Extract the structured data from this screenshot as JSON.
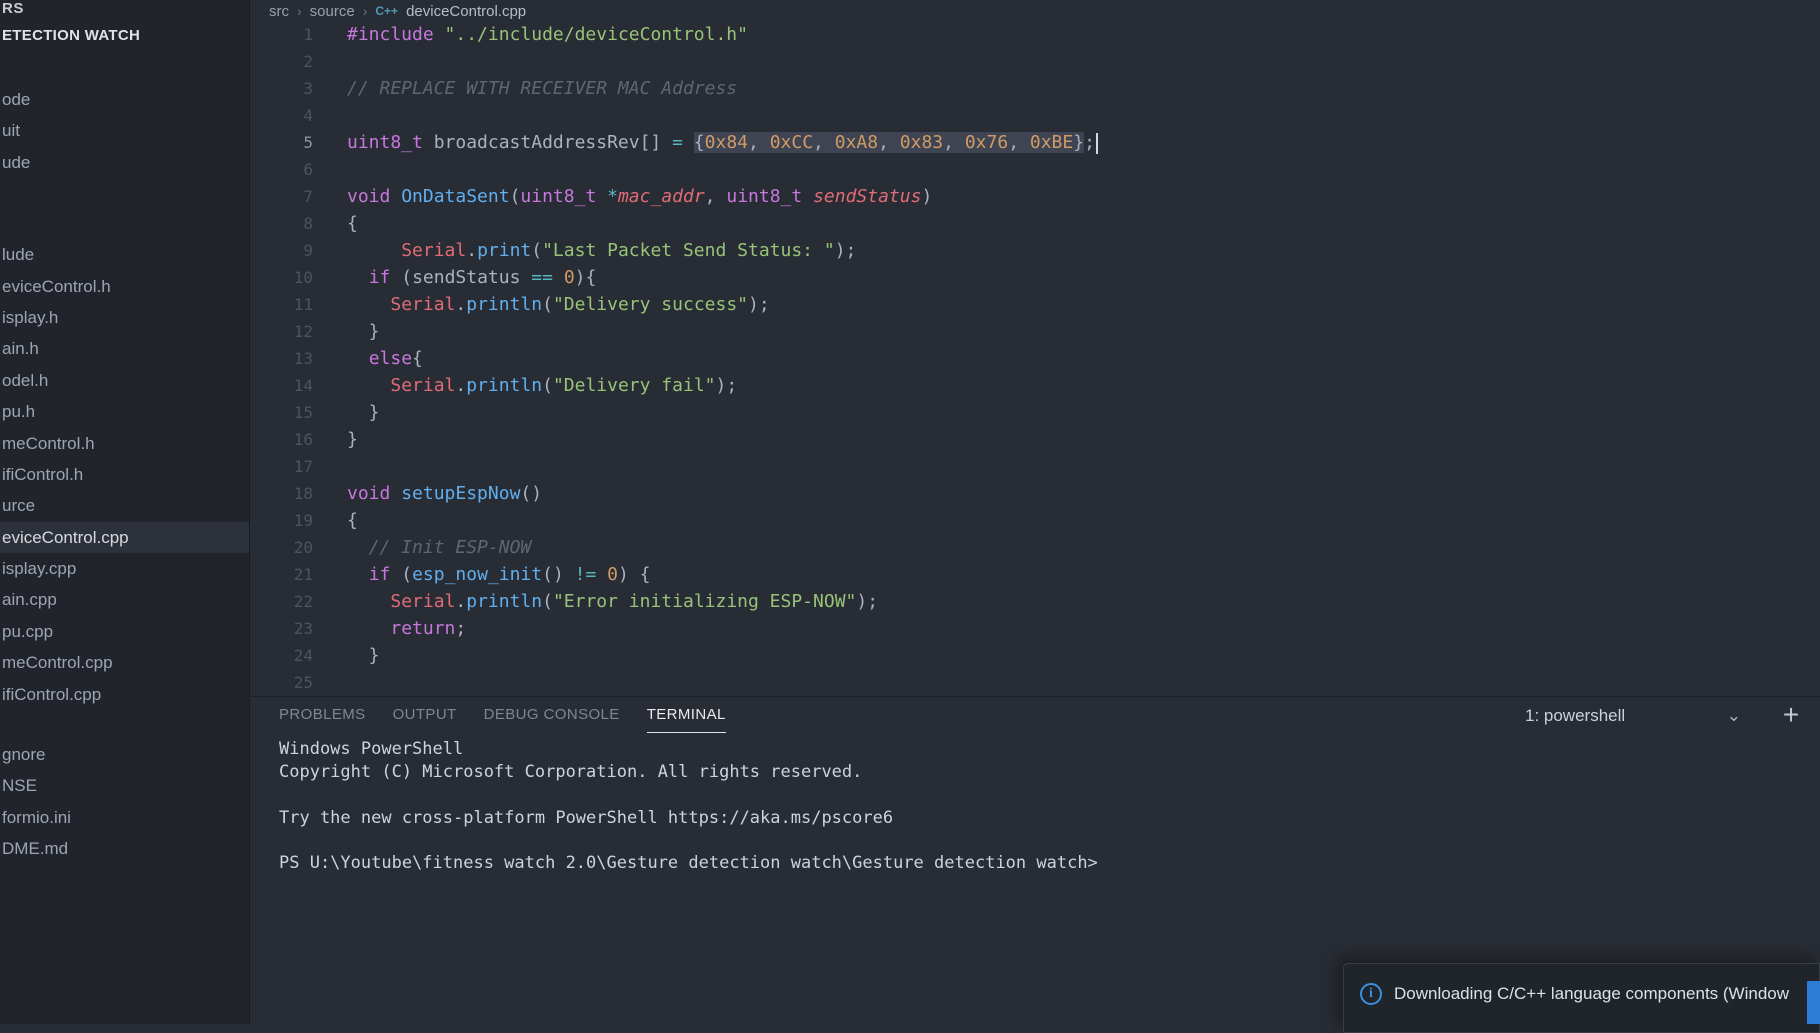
{
  "colors": {
    "editor_bg": "#282c34",
    "sidebar_bg": "#21252b",
    "keyword": "#c678dd",
    "function": "#61afef",
    "string": "#98c379",
    "number": "#d19a66",
    "comment": "#5c6370",
    "variable": "#e06c75",
    "operator": "#56b6c2",
    "selection": "#3e4451",
    "info_blue": "#3d8fd9",
    "file_icon_blue": "#519aba"
  },
  "sidebar": {
    "top_label": "RS",
    "section_header": "ETECTION WATCH",
    "groups": [
      {
        "items": [
          {
            "label": "ode"
          },
          {
            "label": "uit"
          },
          {
            "label": "ude"
          }
        ]
      },
      {
        "items": [
          {
            "label": "lude"
          },
          {
            "label": "eviceControl.h"
          },
          {
            "label": "isplay.h"
          },
          {
            "label": "ain.h"
          },
          {
            "label": "odel.h"
          },
          {
            "label": "pu.h"
          },
          {
            "label": "meControl.h"
          },
          {
            "label": "ifiControl.h"
          },
          {
            "label": "urce"
          },
          {
            "label": "eviceControl.cpp",
            "selected": true
          },
          {
            "label": "isplay.cpp"
          },
          {
            "label": "ain.cpp"
          },
          {
            "label": "pu.cpp"
          },
          {
            "label": "meControl.cpp"
          },
          {
            "label": "ifiControl.cpp"
          }
        ]
      },
      {
        "items": [
          {
            "label": "gnore"
          },
          {
            "label": "NSE"
          },
          {
            "label": "formio.ini"
          },
          {
            "label": "DME.md"
          }
        ]
      }
    ]
  },
  "editor": {
    "breadcrumb": {
      "parts": [
        "src",
        "source",
        "deviceControl.cpp"
      ],
      "separator": "›",
      "file_icon": "C++"
    },
    "lines": [
      {
        "num": 1,
        "tokens": [
          [
            "kw",
            "#include"
          ],
          [
            "p",
            " "
          ],
          [
            "str",
            "\"../include/deviceControl.h\""
          ]
        ]
      },
      {
        "num": 2,
        "tokens": []
      },
      {
        "num": 3,
        "tokens": [
          [
            "cmt",
            "// REPLACE WITH RECEIVER MAC Address"
          ]
        ]
      },
      {
        "num": 4,
        "tokens": []
      },
      {
        "num": 5,
        "active": true,
        "cursor": true,
        "tokens": [
          [
            "kw",
            "uint8_t"
          ],
          [
            "p",
            " broadcastAddressRev[] "
          ],
          [
            "op",
            "="
          ],
          [
            "p",
            " "
          ],
          [
            "p",
            "{",
            1
          ],
          [
            "num",
            "0x84",
            1
          ],
          [
            "p",
            ", ",
            1
          ],
          [
            "num",
            "0xCC",
            1
          ],
          [
            "p",
            ", ",
            1
          ],
          [
            "num",
            "0xA8",
            1
          ],
          [
            "p",
            ", ",
            1
          ],
          [
            "num",
            "0x83",
            1
          ],
          [
            "p",
            ", ",
            1
          ],
          [
            "num",
            "0x76",
            1
          ],
          [
            "p",
            ", ",
            1
          ],
          [
            "num",
            "0xBE",
            1
          ],
          [
            "p",
            "}",
            1
          ],
          [
            "p",
            ";"
          ]
        ]
      },
      {
        "num": 6,
        "tokens": []
      },
      {
        "num": 7,
        "tokens": [
          [
            "kw",
            "void"
          ],
          [
            "p",
            " "
          ],
          [
            "fn",
            "OnDataSent"
          ],
          [
            "p",
            "("
          ],
          [
            "kw",
            "uint8_t"
          ],
          [
            "p",
            " "
          ],
          [
            "op",
            "*"
          ],
          [
            "vi",
            "mac_addr"
          ],
          [
            "p",
            ", "
          ],
          [
            "kw",
            "uint8_t"
          ],
          [
            "p",
            " "
          ],
          [
            "vi",
            "sendStatus"
          ],
          [
            "p",
            ")"
          ]
        ]
      },
      {
        "num": 8,
        "tokens": [
          [
            "p",
            "{"
          ]
        ]
      },
      {
        "num": 9,
        "tokens": [
          [
            "p",
            "     "
          ],
          [
            "obj",
            "Serial"
          ],
          [
            "p",
            "."
          ],
          [
            "fn",
            "print"
          ],
          [
            "p",
            "("
          ],
          [
            "str",
            "\"Last Packet Send Status: \""
          ],
          [
            "p",
            ");"
          ]
        ]
      },
      {
        "num": 10,
        "tokens": [
          [
            "p",
            "  "
          ],
          [
            "kw",
            "if"
          ],
          [
            "p",
            " ("
          ],
          [
            "p",
            "sendStatus"
          ],
          [
            "p",
            " "
          ],
          [
            "op",
            "=="
          ],
          [
            "p",
            " "
          ],
          [
            "num",
            "0"
          ],
          [
            "p",
            "){"
          ]
        ]
      },
      {
        "num": 11,
        "tokens": [
          [
            "p",
            "    "
          ],
          [
            "obj",
            "Serial"
          ],
          [
            "p",
            "."
          ],
          [
            "fn",
            "println"
          ],
          [
            "p",
            "("
          ],
          [
            "str",
            "\"Delivery success\""
          ],
          [
            "p",
            ");"
          ]
        ]
      },
      {
        "num": 12,
        "tokens": [
          [
            "p",
            "  }"
          ]
        ]
      },
      {
        "num": 13,
        "tokens": [
          [
            "p",
            "  "
          ],
          [
            "kw",
            "else"
          ],
          [
            "p",
            "{"
          ]
        ]
      },
      {
        "num": 14,
        "tokens": [
          [
            "p",
            "    "
          ],
          [
            "obj",
            "Serial"
          ],
          [
            "p",
            "."
          ],
          [
            "fn",
            "println"
          ],
          [
            "p",
            "("
          ],
          [
            "str",
            "\"Delivery fail\""
          ],
          [
            "p",
            ");"
          ]
        ]
      },
      {
        "num": 15,
        "tokens": [
          [
            "p",
            "  }"
          ]
        ]
      },
      {
        "num": 16,
        "tokens": [
          [
            "p",
            "}"
          ]
        ]
      },
      {
        "num": 17,
        "tokens": []
      },
      {
        "num": 18,
        "tokens": [
          [
            "kw",
            "void"
          ],
          [
            "p",
            " "
          ],
          [
            "fn",
            "setupEspNow"
          ],
          [
            "p",
            "()"
          ]
        ]
      },
      {
        "num": 19,
        "tokens": [
          [
            "p",
            "{"
          ]
        ]
      },
      {
        "num": 20,
        "tokens": [
          [
            "p",
            "  "
          ],
          [
            "cmt",
            "// Init ESP-NOW"
          ]
        ]
      },
      {
        "num": 21,
        "tokens": [
          [
            "p",
            "  "
          ],
          [
            "kw",
            "if"
          ],
          [
            "p",
            " ("
          ],
          [
            "fn",
            "esp_now_init"
          ],
          [
            "p",
            "() "
          ],
          [
            "op",
            "!="
          ],
          [
            "p",
            " "
          ],
          [
            "num",
            "0"
          ],
          [
            "p",
            ") {"
          ]
        ]
      },
      {
        "num": 22,
        "tokens": [
          [
            "p",
            "    "
          ],
          [
            "obj",
            "Serial"
          ],
          [
            "p",
            "."
          ],
          [
            "fn",
            "println"
          ],
          [
            "p",
            "("
          ],
          [
            "str",
            "\"Error initializing ESP-NOW\""
          ],
          [
            "p",
            ");"
          ]
        ]
      },
      {
        "num": 23,
        "tokens": [
          [
            "p",
            "    "
          ],
          [
            "kw",
            "return"
          ],
          [
            "p",
            ";"
          ]
        ]
      },
      {
        "num": 24,
        "tokens": [
          [
            "p",
            "  }"
          ]
        ]
      },
      {
        "num": 25,
        "tokens": []
      }
    ]
  },
  "panel": {
    "tabs": [
      {
        "label": "PROBLEMS"
      },
      {
        "label": "OUTPUT"
      },
      {
        "label": "DEBUG CONSOLE"
      },
      {
        "label": "TERMINAL",
        "active": true
      }
    ],
    "terminal_selector": {
      "value": "1: powershell",
      "chevron": "⌄"
    },
    "add_terminal_label": "+",
    "terminal": {
      "lines": [
        "Windows PowerShell",
        "Copyright (C) Microsoft Corporation. All rights reserved.",
        "",
        "Try the new cross-platform PowerShell https://aka.ms/pscore6",
        "",
        "PS U:\\Youtube\\fitness watch 2.0\\Gesture detection watch\\Gesture detection watch>"
      ]
    }
  },
  "notification": {
    "icon": "i",
    "message": "Downloading C/C++ language components (Window"
  }
}
